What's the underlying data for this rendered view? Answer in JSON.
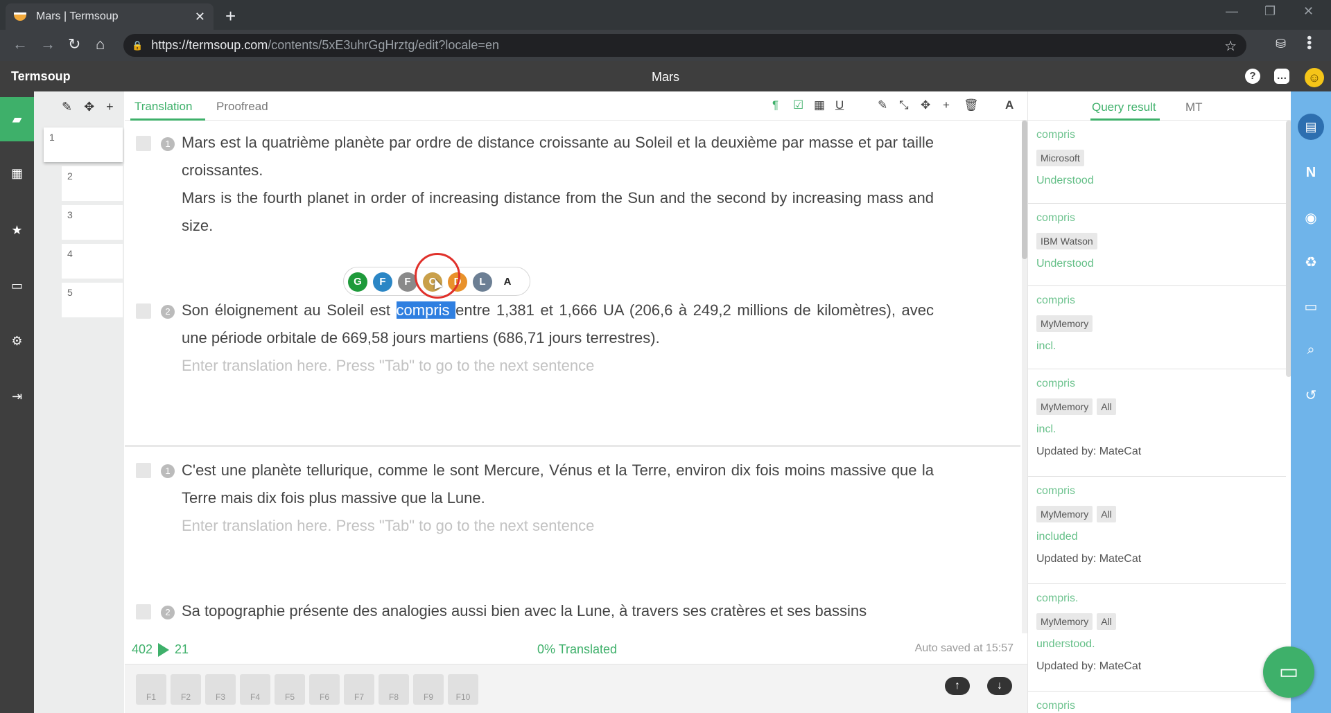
{
  "browser": {
    "tab_title": "Mars | Termsoup",
    "tab_close": "✕",
    "new_tab": "+",
    "url_host": "https://termsoup.com",
    "url_path": "/contents/5xE3uhrGgHrztg/edit?locale=en",
    "window_controls": [
      "—",
      "❐",
      "✕"
    ]
  },
  "header": {
    "brand": "Termsoup",
    "document_title": "Mars",
    "icons": [
      "help-icon",
      "chat-icon",
      "smiley-avatar"
    ]
  },
  "left_sidebar": {
    "items": [
      "folder-open-icon",
      "film-icon",
      "star-icon",
      "inbox-icon",
      "gear-icon",
      "sign-out-icon"
    ]
  },
  "segments_column": {
    "tools": "✎ ✥ +",
    "numbers": [
      "1",
      "2",
      "3",
      "4",
      "5"
    ]
  },
  "editor": {
    "tabs": [
      "Translation",
      "Proofread"
    ],
    "active_tab": "Translation",
    "toolbar_icons": [
      "paragraph-icon",
      "check-square-icon",
      "grid-icon",
      "underline-icon",
      "pencil-icon",
      "compress-icon",
      "move-icon",
      "plus-icon",
      "trash-icon",
      "font-icon"
    ],
    "segments": [
      {
        "num": "1",
        "source": "Mars est la quatrième planète par ordre de distance croissante au Soleil et la deuxième par masse et par taille croissantes.",
        "target": "Mars is the fourth planet in order of increasing distance from the Sun and the second by increasing mass and size."
      },
      {
        "num": "2",
        "source_before": "Son éloignement au Soleil est ",
        "source_highlight": "compris ",
        "source_after": "entre 1,381 et 1,666 UA (206,6 à 249,2 millions de kilomètres), avec une période orbitale de 669,58 jours martiens (686,71 jours terrestres).",
        "placeholder": "Enter translation here. Press \"Tab\" to go to the next sentence"
      },
      {
        "num": "1",
        "source": "C'est une planète tellurique, comme le sont Mercure, Vénus et la Terre, environ dix fois moins massive que la Terre mais dix fois plus massive que la Lune.",
        "placeholder": "Enter translation here. Press \"Tab\" to go to the next sentence"
      },
      {
        "num": "2",
        "source": "Sa topographie présente des analogies aussi bien avec la Lune, à travers ses cratères et ses bassins"
      }
    ],
    "mt_engines": [
      {
        "letter": "G",
        "color": "#1e9a3a"
      },
      {
        "letter": "F",
        "color": "#2b86c5"
      },
      {
        "letter": "F",
        "color": "#8a8a8a"
      },
      {
        "letter": "C",
        "color": "#c9a04a"
      },
      {
        "letter": "D",
        "color": "#e8912b"
      },
      {
        "letter": "L",
        "color": "#6c7f94"
      },
      {
        "letter": "A",
        "color": "#ffffff"
      }
    ],
    "status": {
      "words": "402",
      "segments": "21",
      "translated": "0% Translated",
      "autosave": "Auto saved at 15:57"
    },
    "fkeys": [
      "F1",
      "F2",
      "F3",
      "F4",
      "F5",
      "F6",
      "F7",
      "F8",
      "F9",
      "F10"
    ]
  },
  "results": {
    "tabs": [
      "Query result",
      "MT"
    ],
    "active_tab": "Query result",
    "cards": [
      {
        "source": "compris",
        "tags": [
          "Microsoft"
        ],
        "target": "Understood",
        "updated": ""
      },
      {
        "source": "compris",
        "tags": [
          "IBM Watson"
        ],
        "target": "Understood",
        "updated": ""
      },
      {
        "source": "compris",
        "tags": [
          "MyMemory"
        ],
        "target": "incl.",
        "updated": ""
      },
      {
        "source": "compris",
        "tags": [
          "MyMemory",
          "All"
        ],
        "target": "incl.",
        "updated": "Updated by: MateCat"
      },
      {
        "source": "compris",
        "tags": [
          "MyMemory",
          "All"
        ],
        "target": "included",
        "updated": "Updated by: MateCat"
      },
      {
        "source": "compris.",
        "tags": [
          "MyMemory",
          "All"
        ],
        "target": "understood.",
        "updated": "Updated by: MateCat"
      },
      {
        "source": "compris",
        "tags": [],
        "target": "",
        "updated": ""
      }
    ]
  },
  "right_sidebar": {
    "items": [
      "notebook-icon",
      "n-icon",
      "eye-icon",
      "recycle-icon",
      "comment-icon",
      "search-icon",
      "history-icon"
    ]
  },
  "colors": {
    "accent": "#3eb06a",
    "sidebar_blue": "#6fb4ea",
    "highlight": "#2f7fe0"
  }
}
